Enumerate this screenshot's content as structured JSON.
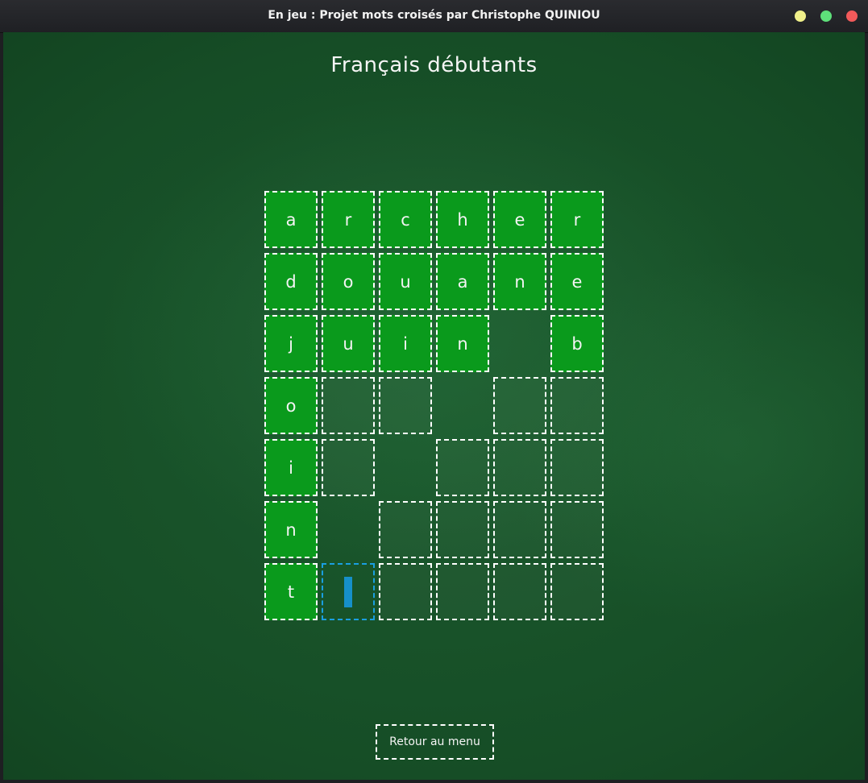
{
  "window": {
    "title": "En jeu : Projet mots croisés par Christophe QUINIOU",
    "controls": {
      "minimize_color": "#f0f08a",
      "maximize_color": "#5ee07a",
      "close_color": "#f25a5a"
    }
  },
  "game": {
    "heading": "Français débutants",
    "colors": {
      "filled_cell": "#0a9a1c",
      "active_border": "#1a9fe0",
      "cursor": "#1690c9"
    },
    "grid": {
      "rows": 7,
      "cols": 6,
      "cells": [
        [
          "a",
          "r",
          "c",
          "h",
          "e",
          "r"
        ],
        [
          "d",
          "o",
          "u",
          "a",
          "n",
          "e"
        ],
        [
          "j",
          "u",
          "i",
          "n",
          null,
          "b"
        ],
        [
          "o",
          "",
          "",
          null,
          "",
          ""
        ],
        [
          "i",
          "",
          null,
          "",
          "",
          ""
        ],
        [
          "n",
          null,
          "",
          "",
          "",
          ""
        ],
        [
          "t",
          "",
          "",
          "",
          "",
          ""
        ]
      ],
      "active_cell": {
        "row": 6,
        "col": 1
      }
    },
    "back_button_label": "Retour au menu"
  }
}
